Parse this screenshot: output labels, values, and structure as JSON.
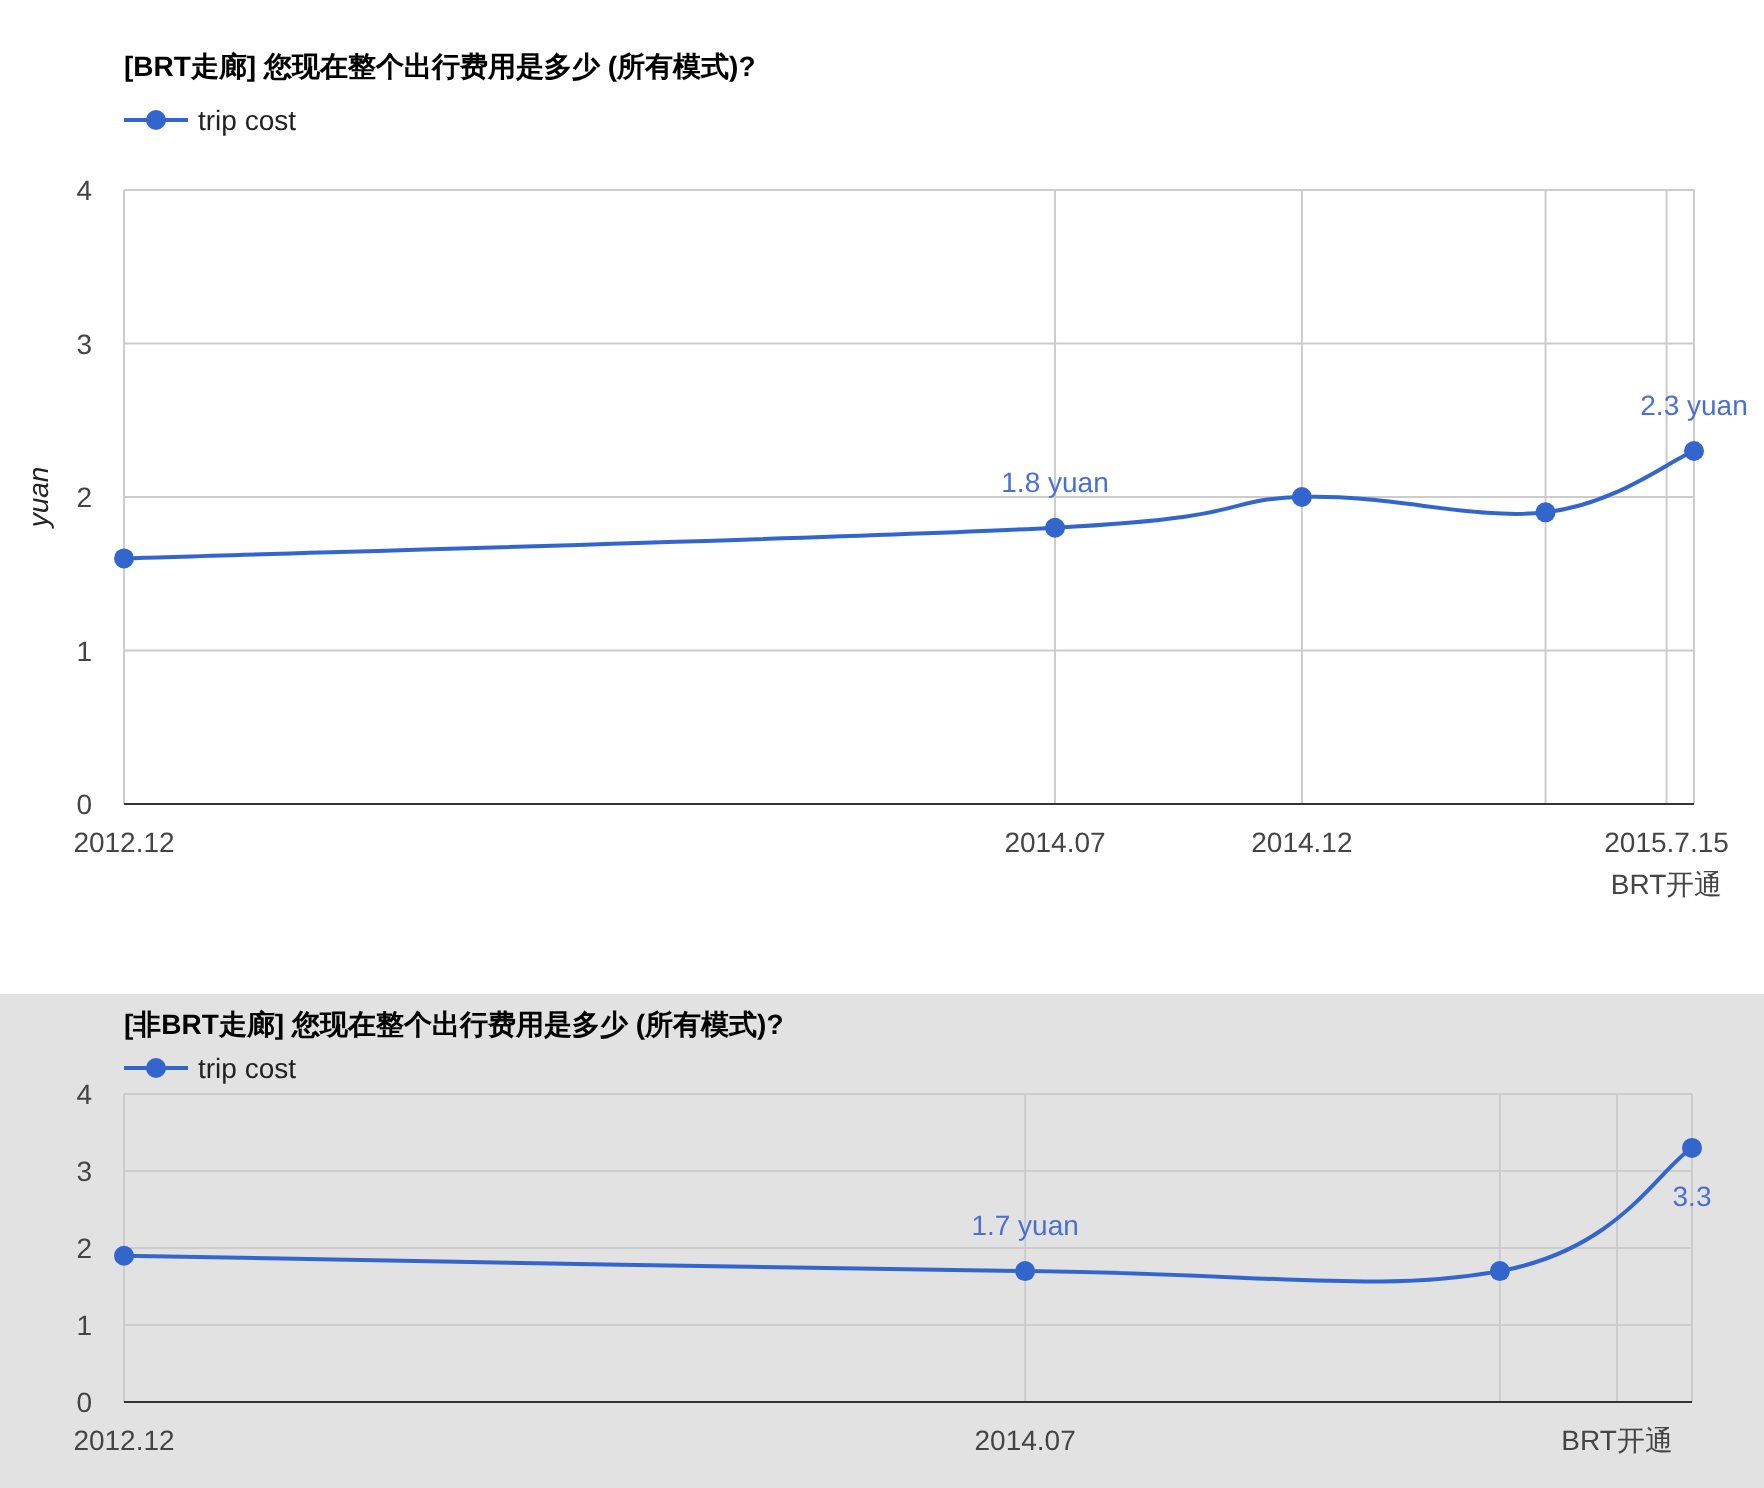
{
  "charts": [
    {
      "chart_data": {
        "type": "line",
        "title": "[BRT走廊] 您现在整个出行费用是多少 (所有模式)?",
        "ylabel": "yuan",
        "x": [
          "2012-12-01",
          "2014-07-01",
          "2014-12-01",
          "2015-05-01",
          "2015-08-01"
        ],
        "xlim": [
          "2012-12-01",
          "2015-08-01"
        ],
        "ylim": [
          0,
          4
        ],
        "yticks": [
          0,
          1,
          2,
          3,
          4
        ],
        "grid": true,
        "xticks": [
          {
            "value": "2012-12-01",
            "label": "2012.12"
          },
          {
            "value": "2014-07-01",
            "label": "2014.07"
          },
          {
            "value": "2014-12-01",
            "label": "2014.12"
          },
          {
            "value": "2015-07-15",
            "label": "2015.7.15\nBRT开通"
          }
        ],
        "series": [
          {
            "name": "trip cost",
            "color": "#3366cc",
            "values": [
              1.6,
              1.8,
              2.0,
              1.9,
              2.3
            ],
            "marker": "o"
          }
        ],
        "annotations": [
          {
            "x": "2014-07-01",
            "y": 1.8,
            "text": "1.8 yuan"
          },
          {
            "x": "2015-08-01",
            "y": 2.3,
            "text": "2.3 yuan"
          }
        ]
      }
    },
    {
      "chart_data": {
        "type": "line",
        "title": "[非BRT走廊] 您现在整个出行费用是多少 (所有模式)?",
        "x": [
          "2012-12-01",
          "2014-07-01",
          "2015-05-01",
          "2015-09-01"
        ],
        "xlim": [
          "2012-12-01",
          "2015-09-01"
        ],
        "ylim": [
          0,
          4
        ],
        "yticks": [
          0,
          1,
          2,
          3,
          4
        ],
        "grid": true,
        "xticks": [
          {
            "value": "2012-12-01",
            "label": "2012.12"
          },
          {
            "value": "2014-07-01",
            "label": "2014.07"
          },
          {
            "value": "2015-07-15",
            "label": "BRT开通"
          }
        ],
        "series": [
          {
            "name": "trip cost",
            "color": "#3366cc",
            "values": [
              1.9,
              1.7,
              1.7,
              3.3
            ],
            "marker": "o"
          }
        ],
        "annotations": [
          {
            "x": "2014-07-01",
            "y": 1.7,
            "text": "1.7 yuan"
          },
          {
            "x": "2015-09-01",
            "y": 3.3,
            "text": "3.3"
          }
        ]
      }
    }
  ]
}
